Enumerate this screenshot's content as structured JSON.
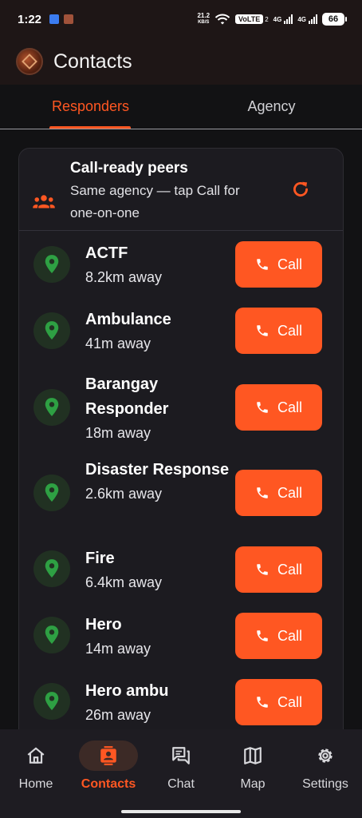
{
  "status_bar": {
    "time": "1:22",
    "speed_value": "21.2",
    "speed_unit": "KB/S",
    "volte": "VoLTE",
    "volte_sub": "2",
    "net1": "4G",
    "net2": "4G",
    "battery": "66"
  },
  "app_bar": {
    "title": "Contacts"
  },
  "tabs": [
    {
      "label": "Responders",
      "active": true
    },
    {
      "label": "Agency",
      "active": false
    }
  ],
  "card": {
    "title": "Call-ready peers",
    "subtitle": "Same agency — tap Call for one-on-one"
  },
  "contacts": [
    {
      "name": "ACTF",
      "distance": "8.2km away",
      "call_label": "Call"
    },
    {
      "name": "Ambulance",
      "distance": "41m away",
      "call_label": "Call"
    },
    {
      "name": "Barangay Responder",
      "distance": "18m away",
      "call_label": "Call"
    },
    {
      "name": "Disaster Response",
      "distance": "2.6km away",
      "call_label": "Call"
    },
    {
      "name": "Fire",
      "distance": "6.4km away",
      "call_label": "Call"
    },
    {
      "name": "Hero",
      "distance": "14m away",
      "call_label": "Call"
    },
    {
      "name": "Hero ambu",
      "distance": "26m away",
      "call_label": "Call"
    }
  ],
  "bottom_nav": [
    {
      "label": "Home",
      "icon": "home-icon",
      "active": false
    },
    {
      "label": "Contacts",
      "icon": "contacts-icon",
      "active": true
    },
    {
      "label": "Chat",
      "icon": "chat-icon",
      "active": false
    },
    {
      "label": "Map",
      "icon": "map-icon",
      "active": false
    },
    {
      "label": "Settings",
      "icon": "settings-icon",
      "active": false
    }
  ],
  "colors": {
    "accent": "#ff5722",
    "pin_green": "#2ea043",
    "background": "#121214",
    "card": "#1c1b20"
  }
}
